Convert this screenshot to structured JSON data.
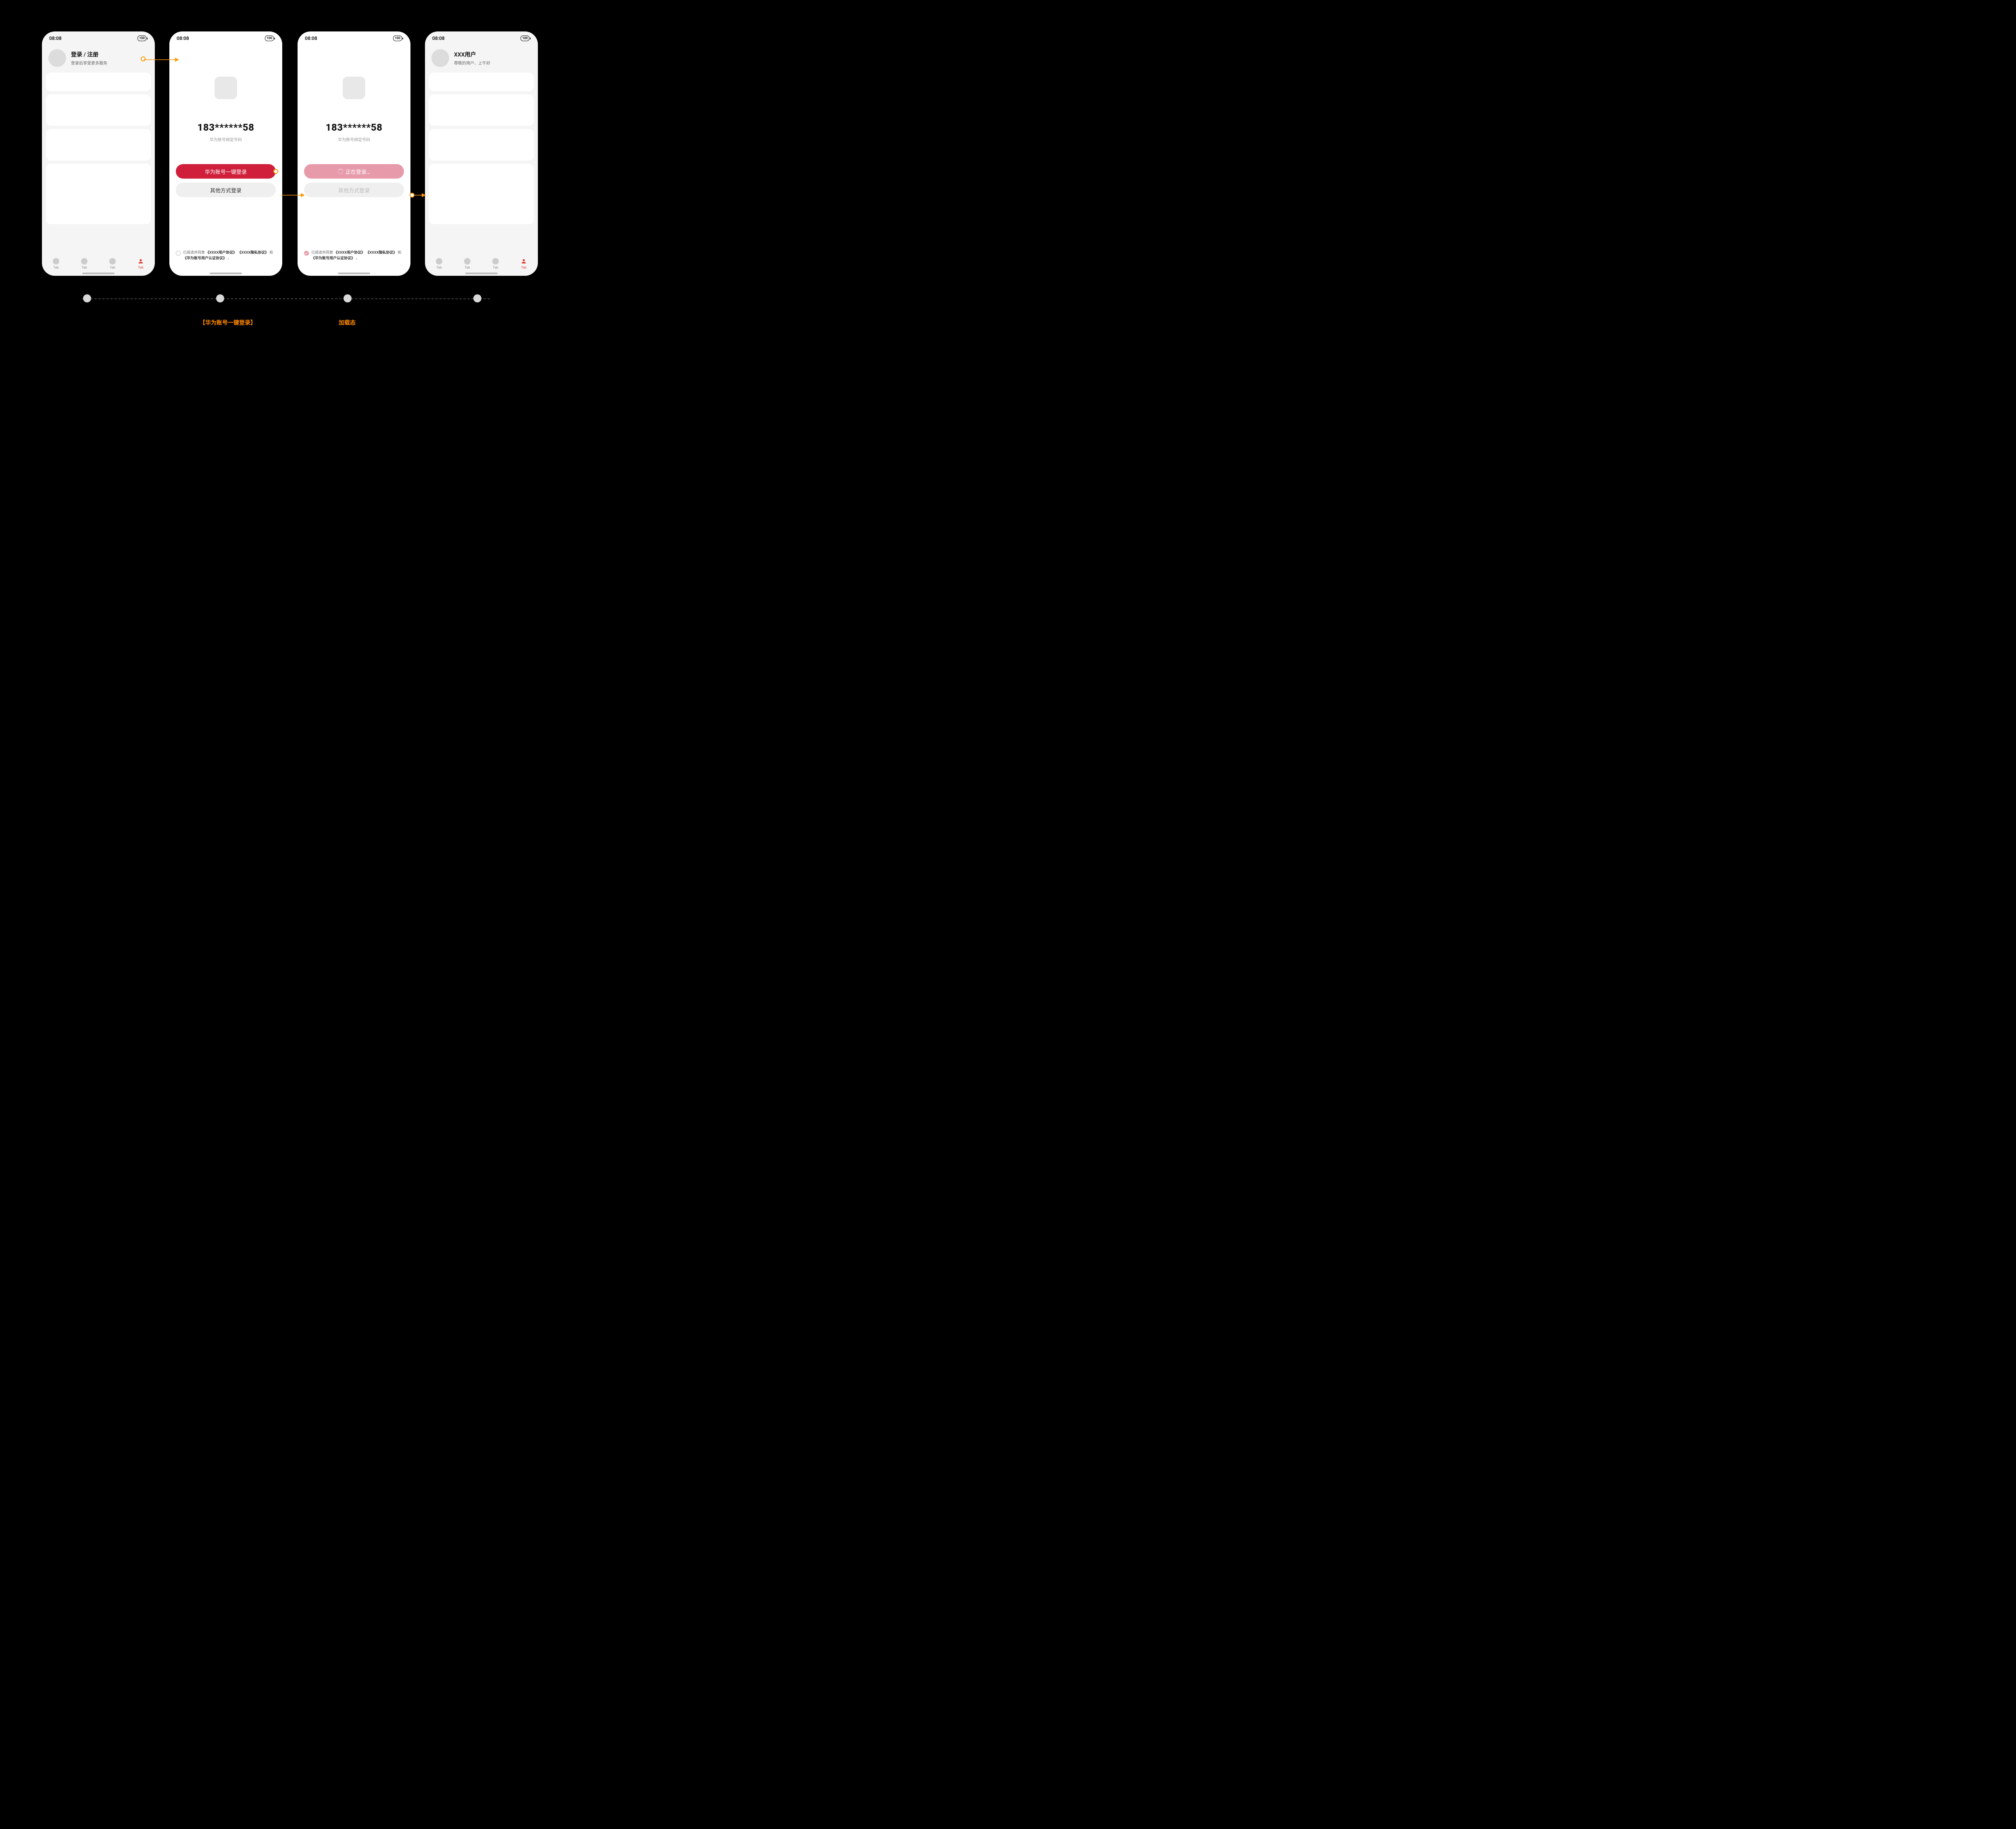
{
  "status": {
    "time": "08:08",
    "battery": "100"
  },
  "screen1": {
    "title": "登录 / 注册",
    "subtitle": "登录后享受更多服务",
    "tab": "Tab"
  },
  "screen2": {
    "phone": "183******58",
    "phone_sub": "华为账号绑定号码",
    "btn_primary": "华为账号一键登录",
    "btn_secondary": "其他方式登录",
    "agree_prefix": "已阅读并同意",
    "link1": "《XXXX用户协议》",
    "link2": "《XXXX隐私协议》",
    "agree_mid": "和",
    "link3": "《华为账号用户认证协议》",
    "agree_suffix": "。"
  },
  "screen3": {
    "phone": "183******58",
    "phone_sub": "华为账号绑定号码",
    "btn_primary": "正在登录…",
    "btn_secondary": "其他方式登录",
    "agree_prefix": "已阅读并同意",
    "link1": "《XXXX用户协议》",
    "link2": "《XXXX隐私协议》",
    "agree_mid": "和",
    "link3": "《华为账号用户认证协议》",
    "agree_suffix": "。"
  },
  "screen4": {
    "title": "XXX用户",
    "subtitle": "尊敬的用户，上午好",
    "tab": "Tab"
  },
  "captions": {
    "c2": "【华为账号一键登录】",
    "c3": "加载态"
  }
}
